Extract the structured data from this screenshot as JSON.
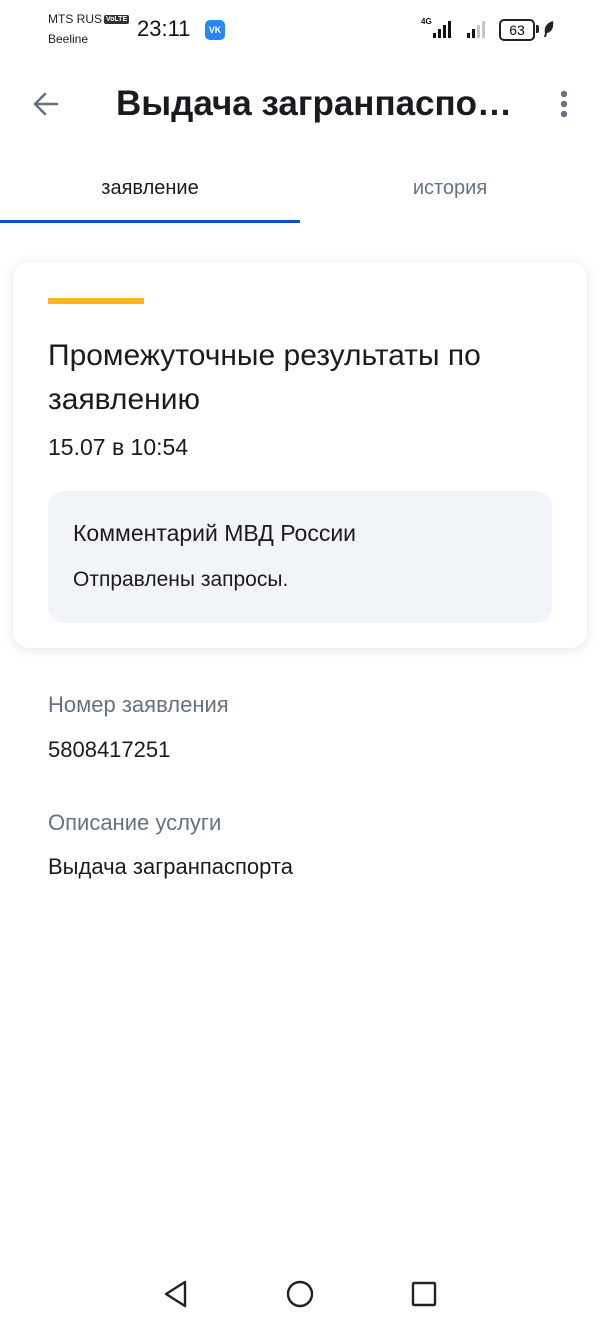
{
  "status_bar": {
    "carrier_primary": "MTS RUS",
    "volte": "VoLTE",
    "carrier_secondary": "Beeline",
    "time": "23:11",
    "notification_app": "VK",
    "network_type": "4G",
    "battery_level": "63"
  },
  "app_bar": {
    "title": "Выдача загранпаспорта"
  },
  "tabs": [
    {
      "label": "заявление",
      "active": true
    },
    {
      "label": "история",
      "active": false
    }
  ],
  "status_card": {
    "title": "Промежуточные результаты по заявлению",
    "date": "15.07 в 10:54",
    "comment": {
      "title": "Комментарий МВД России",
      "text": "Отправлены запросы."
    }
  },
  "details": {
    "application_number": {
      "label": "Номер заявления",
      "value": "5808417251"
    },
    "service_description": {
      "label": "Описание услуги",
      "value": "Выдача загранпаспорта"
    }
  },
  "colors": {
    "accent_blue": "#0d4cd3",
    "accent_yellow": "#f8b81c",
    "secondary_text": "#66727f",
    "comment_background": "#f1f5fa"
  }
}
